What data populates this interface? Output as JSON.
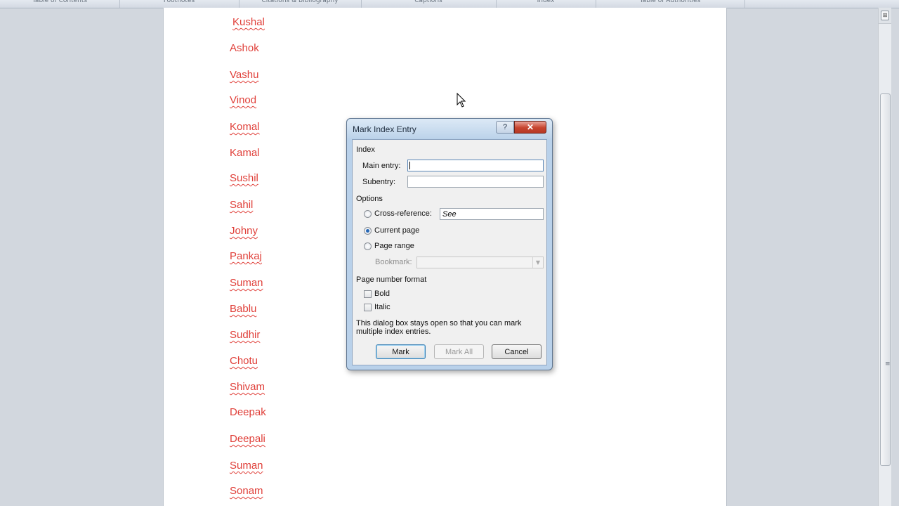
{
  "ribbon": {
    "groups": [
      "Table of Contents",
      "Footnotes",
      "Citations & Bibliography",
      "Captions",
      "Index",
      "Table of Authorities"
    ]
  },
  "document": {
    "names": [
      {
        "text": "Kushal",
        "spell_flag": true
      },
      {
        "text": "Ashok",
        "spell_flag": false
      },
      {
        "text": "Vashu",
        "spell_flag": true
      },
      {
        "text": "Vinod",
        "spell_flag": true
      },
      {
        "text": "Komal",
        "spell_flag": true
      },
      {
        "text": "Kamal",
        "spell_flag": false
      },
      {
        "text": "Sushil",
        "spell_flag": true
      },
      {
        "text": "Sahil",
        "spell_flag": true
      },
      {
        "text": "Johny",
        "spell_flag": true
      },
      {
        "text": "Pankaj",
        "spell_flag": true
      },
      {
        "text": "Suman",
        "spell_flag": true
      },
      {
        "text": "Bablu",
        "spell_flag": true
      },
      {
        "text": "Sudhir",
        "spell_flag": true
      },
      {
        "text": "Chotu",
        "spell_flag": true
      },
      {
        "text": "Shivam",
        "spell_flag": true
      },
      {
        "text": "Deepak",
        "spell_flag": false
      },
      {
        "text": "Deepali",
        "spell_flag": true
      },
      {
        "text": "Suman",
        "spell_flag": true
      },
      {
        "text": "Sonam",
        "spell_flag": true
      }
    ],
    "text_color": "#e0403a"
  },
  "dialog": {
    "title": "Mark Index Entry",
    "help_label": "?",
    "close_label": "✕",
    "index_section": "Index",
    "main_entry_label": "Main entry:",
    "main_entry_value": "",
    "subentry_label": "Subentry:",
    "subentry_value": "",
    "options_section": "Options",
    "cross_reference_label": "Cross-reference:",
    "cross_reference_value": "See",
    "current_page_label": "Current page",
    "current_page_selected": true,
    "page_range_label": "Page range",
    "bookmark_label": "Bookmark:",
    "page_number_format_section": "Page number format",
    "bold_label": "Bold",
    "italic_label": "Italic",
    "note": "This dialog box stays open so that you can mark multiple index entries.",
    "mark_button": "Mark",
    "mark_all_button": "Mark All",
    "cancel_button": "Cancel"
  }
}
